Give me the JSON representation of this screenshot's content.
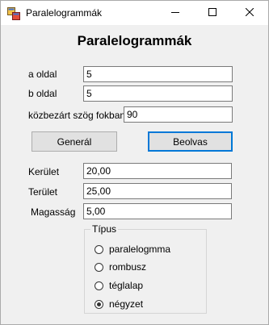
{
  "window": {
    "title": "Paralelogrammák"
  },
  "form": {
    "heading": "Paralelogrammák",
    "inputs": [
      {
        "label": "a oldal",
        "value": "5"
      },
      {
        "label": "b oldal",
        "value": "5"
      },
      {
        "label": "közbezárt szög fokban",
        "value": "90"
      }
    ],
    "buttons": {
      "generate": "Generál",
      "read": "Beolvas"
    },
    "outputs": [
      {
        "label": "Kerület",
        "value": "20,00"
      },
      {
        "label": "Terület",
        "value": "25,00"
      },
      {
        "label": "Magasság",
        "value": "5,00"
      }
    ],
    "type_group": {
      "legend": "Típus",
      "options": [
        {
          "label": "paralelogmma",
          "checked": false
        },
        {
          "label": "rombusz",
          "checked": false
        },
        {
          "label": "téglalap",
          "checked": false
        },
        {
          "label": "négyzet",
          "checked": true
        }
      ]
    }
  }
}
